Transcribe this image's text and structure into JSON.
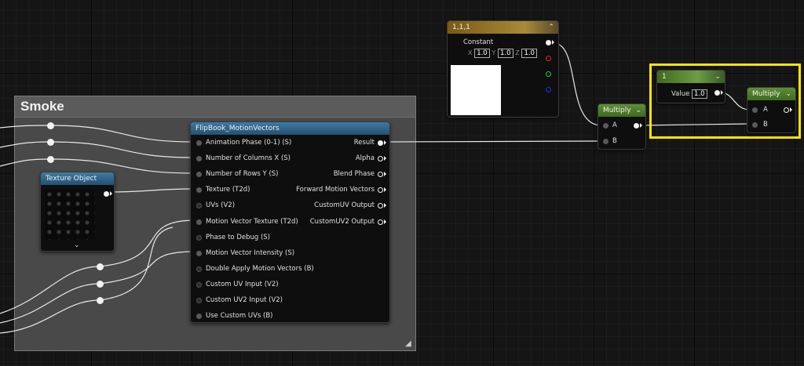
{
  "colors": {
    "accent_selection": "#ffe600",
    "node_header_blue": "#2e5d80",
    "node_header_green": "#4f7a2c",
    "node_header_gold": "#8a6a1e"
  },
  "comment": {
    "title": "Smoke"
  },
  "flipbook": {
    "title": "FlipBook_MotionVectors",
    "inputs": [
      "Animation  Phase (0-1) (S)",
      "Number of Columns X (S)",
      "Number of Rows Y (S)",
      "Texture (T2d)",
      "UVs (V2)",
      "Motion Vector Texture (T2d)",
      "Phase to Debug (S)",
      "Motion Vector Intensity (S)",
      "Double Apply Motion Vectors (B)",
      "Custom UV Input (V2)",
      "Custom UV2 Input (V2)",
      "Use Custom UVs (B)"
    ],
    "outputs": [
      "Result",
      "Alpha",
      "Blend Phase",
      "Forward Motion Vectors",
      "CustomUV Output",
      "CustomUV2 Output"
    ]
  },
  "texture_object": {
    "title": "Texture Object",
    "expand_icon": "chevron-down-icon"
  },
  "constant": {
    "title": "1,1,1",
    "label": "Constant",
    "x_label": "X",
    "x": "1.0",
    "y_label": "Y",
    "y": "1.0",
    "z_label": "Z",
    "z": "1.0"
  },
  "multiply1": {
    "title": "Multiply",
    "a": "A",
    "b": "B"
  },
  "scalar": {
    "title": "1",
    "label": "Value",
    "value": "1.0"
  },
  "multiply2": {
    "title": "Multiply",
    "a": "A",
    "b": "B"
  }
}
